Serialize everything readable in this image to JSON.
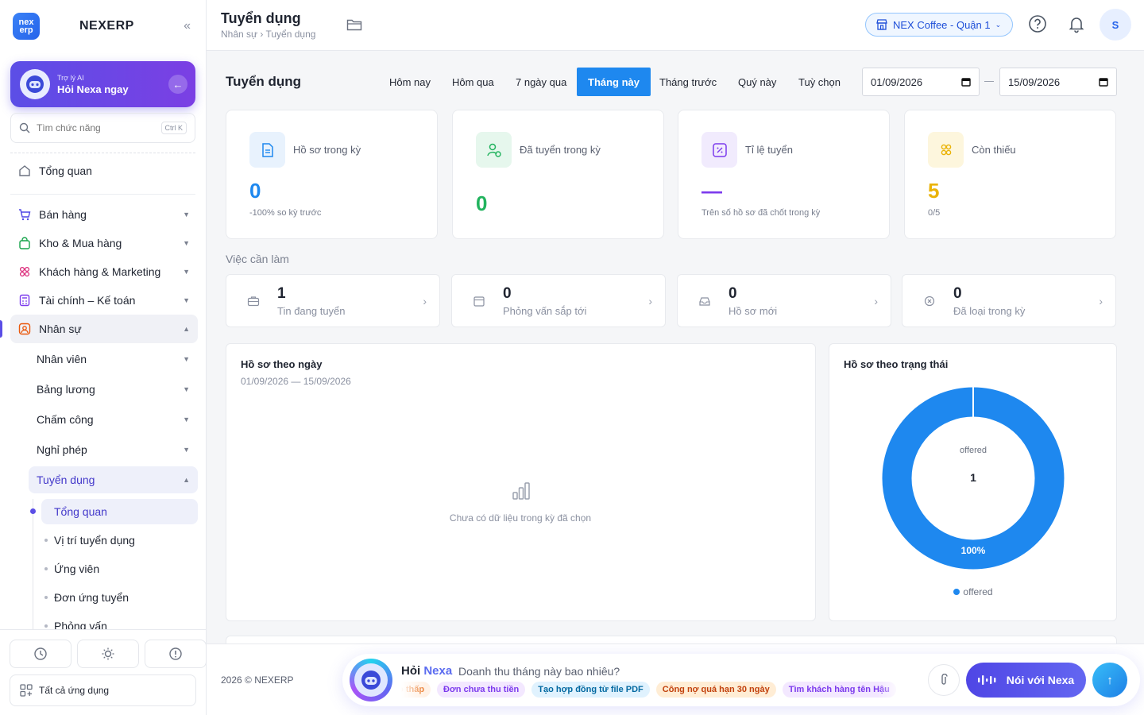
{
  "brand": {
    "name": "NEXERP",
    "logo_text": "nex erp"
  },
  "ai_card": {
    "subtitle": "Trợ lý AI",
    "title": "Hỏi Nexa ngay"
  },
  "sidebar_search": {
    "placeholder": "Tìm chức năng",
    "shortcut": "Ctrl K"
  },
  "nav": {
    "overview": "Tổng quan",
    "sales": "Bán hàng",
    "inventory": "Kho & Mua hàng",
    "crm": "Khách hàng & Marketing",
    "finance": "Tài chính – Kế toán",
    "hr": "Nhân sự",
    "hr_sub": {
      "employees": "Nhân viên",
      "payroll": "Bảng lương",
      "attendance": "Chấm công",
      "leave": "Nghỉ phép",
      "recruit": "Tuyển dụng"
    },
    "recruit_sub": [
      "Tổng quan",
      "Vị trí tuyển dụng",
      "Ứng viên",
      "Đơn ứng tuyển",
      "Phỏng vấn"
    ]
  },
  "all_apps": "Tất cả ứng dụng",
  "header": {
    "title": "Tuyển dụng",
    "breadcrumb": "Nhân sự › Tuyển dụng",
    "branch": "NEX Coffee - Quận 1",
    "avatar": "S"
  },
  "main": {
    "title": "Tuyển dụng",
    "ranges": [
      "Hôm nay",
      "Hôm qua",
      "7 ngày qua",
      "Tháng này",
      "Tháng trước",
      "Quý này",
      "Tuỳ chọn"
    ],
    "active_range": "Tháng này",
    "date_from": "01/09/2026",
    "date_to": "15/09/2026"
  },
  "stats": [
    {
      "label": "Hồ sơ trong kỳ",
      "value": "0",
      "foot": "-100% so kỳ trước",
      "color": "#1e88ef"
    },
    {
      "label": "Đã tuyển trong kỳ",
      "value": "0",
      "foot": "",
      "color": "#22b35e"
    },
    {
      "label": "Tỉ lệ tuyển",
      "value": "—",
      "foot": "Trên số hồ sơ đã chốt trong kỳ",
      "color": "#7c3aed"
    },
    {
      "label": "Còn thiếu",
      "value": "5",
      "foot": "0/5",
      "color": "#eab308"
    }
  ],
  "todo": {
    "label": "Việc cần làm",
    "items": [
      {
        "num": "1",
        "label": "Tin đang tuyển"
      },
      {
        "num": "0",
        "label": "Phỏng vấn sắp tới"
      },
      {
        "num": "0",
        "label": "Hồ sơ mới"
      },
      {
        "num": "0",
        "label": "Đã loại trong kỳ"
      }
    ]
  },
  "by_day": {
    "title": "Hồ sơ theo ngày",
    "range": "01/09/2026 — 15/09/2026",
    "empty": "Chưa có dữ liệu trong kỳ đã chọn"
  },
  "by_status": {
    "title": "Hồ sơ theo trạng thái",
    "center_label": "offered",
    "center_value": "1",
    "percent_label": "100%",
    "legend": "offered",
    "color": "#1e88ef"
  },
  "chart_data": {
    "type": "pie",
    "title": "Hồ sơ theo trạng thái",
    "categories": [
      "offered"
    ],
    "values": [
      1
    ],
    "percent": [
      100
    ]
  },
  "footer": {
    "copyright": "2026 © NEXERP"
  },
  "ask": {
    "title_a": "Hỏi",
    "title_b": "Nexa",
    "question": "Doanh thu tháng này bao nhiêu?",
    "chips": [
      {
        "text": "Tồn kho thấp",
        "bg": "#fff1e6",
        "fg": "#ea7a2c"
      },
      {
        "text": "Đơn chưa thu tiền",
        "bg": "#f3e8ff",
        "fg": "#7c3aed"
      },
      {
        "text": "Tạo hợp đồng từ file PDF",
        "bg": "#e0f2fe",
        "fg": "#0369a1"
      },
      {
        "text": "Công nợ quá hạn 30 ngày",
        "bg": "#ffedd5",
        "fg": "#c2410c"
      },
      {
        "text": "Tìm khách hàng tên Hậu",
        "bg": "#f3e8ff",
        "fg": "#7c3aed"
      }
    ],
    "talk": "Nói với Nexa"
  }
}
